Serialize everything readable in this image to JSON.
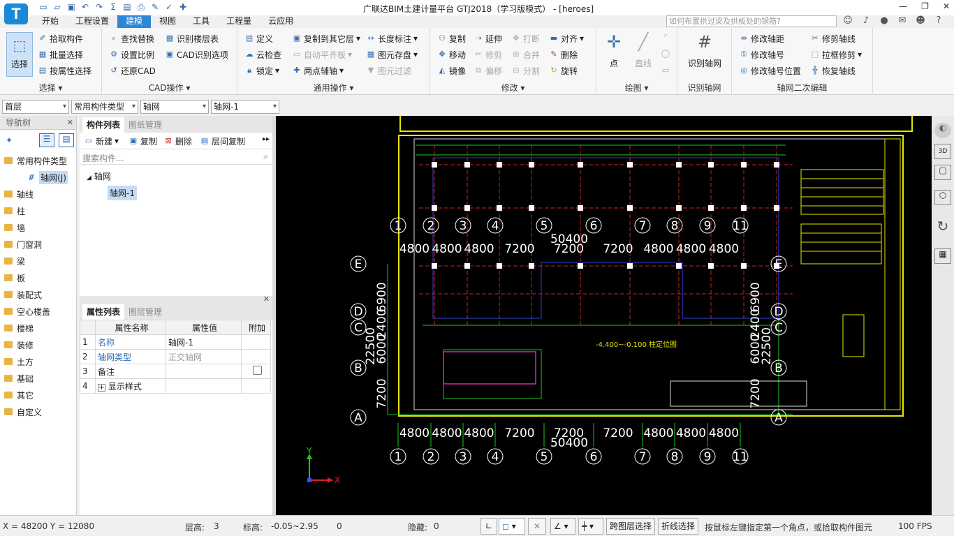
{
  "app": {
    "title": "广联达BIM土建计量平台 GTJ2018（学习版模式） - [heroes]",
    "logo": "T"
  },
  "menu": {
    "tabs": [
      "开始",
      "工程设置",
      "建模",
      "视图",
      "工具",
      "工程量",
      "云应用"
    ],
    "active": "建模"
  },
  "search": {
    "placeholder": "如何布置拱过梁及拱板处的钢筋?"
  },
  "ribbon": {
    "select": {
      "big": "选择",
      "items": [
        "拾取构件",
        "批量选择",
        "按属性选择"
      ],
      "label": "选择"
    },
    "cad": {
      "items": [
        "查找替换",
        "设置比例",
        "还原CAD",
        "识别楼层表",
        "CAD识别选项"
      ],
      "label": "CAD操作"
    },
    "common": {
      "items": [
        "定义",
        "云检查",
        "锁定",
        "复制到其它层",
        "自动平齐板",
        "两点辅轴",
        "长度标注",
        "图元存盘",
        "图元过滤"
      ],
      "label": "通用操作"
    },
    "modify": {
      "items": [
        "复制",
        "移动",
        "镜像",
        "延伸",
        "修剪",
        "偏移",
        "打断",
        "合并",
        "分割",
        "对齐",
        "删除",
        "旋转"
      ],
      "label": "修改"
    },
    "draw": {
      "items": [
        "点",
        "直线"
      ],
      "label": "绘图"
    },
    "identify": {
      "big": "识别轴网",
      "label": "识别轴网"
    },
    "axis2": {
      "items": [
        "修改轴距",
        "修改轴号",
        "修改轴号位置",
        "修剪轴线",
        "拉框修剪",
        "恢复轴线"
      ],
      "label": "轴网二次编辑"
    }
  },
  "toolbar": {
    "floor": "首层",
    "type": "常用构件类型",
    "category": "轴网",
    "element": "轴网-1"
  },
  "nav": {
    "title": "导航树",
    "group": "常用构件类型",
    "selected": "轴网(J)",
    "items": [
      "轴线",
      "柱",
      "墙",
      "门窗洞",
      "梁",
      "板",
      "装配式",
      "空心楼盖",
      "楼梯",
      "装修",
      "土方",
      "基础",
      "其它",
      "自定义"
    ]
  },
  "component_list": {
    "tabs": [
      "构件列表",
      "图纸管理"
    ],
    "actions": [
      "新建",
      "复制",
      "删除",
      "层间复制"
    ],
    "search_placeholder": "搜索构件...",
    "tree_root": "轴网",
    "tree_child": "轴网-1"
  },
  "properties": {
    "tabs": [
      "属性列表",
      "图层管理"
    ],
    "headers": [
      "属性名称",
      "属性值",
      "附加"
    ],
    "rows": [
      {
        "no": "1",
        "name": "名称",
        "value": "轴网-1"
      },
      {
        "no": "2",
        "name": "轴网类型",
        "value": "正交轴网"
      },
      {
        "no": "3",
        "name": "备注",
        "value": ""
      },
      {
        "no": "4",
        "name": "显示样式",
        "value": ""
      }
    ]
  },
  "cad": {
    "top_dims": [
      "4800",
      "4800",
      "4800",
      "7200",
      "7200",
      "7200",
      "4800",
      "4800",
      "4800"
    ],
    "total": "50400",
    "axis_nums": [
      "1",
      "2",
      "3",
      "4",
      "5",
      "6",
      "7",
      "8",
      "9",
      "11"
    ],
    "row_letters": [
      "E",
      "D",
      "C",
      "B",
      "A"
    ],
    "left_dims": [
      "6900",
      "2400",
      "6000",
      "7200"
    ],
    "left_total": "22500",
    "right_dims": [
      "6900",
      "2400",
      "6000",
      "7200"
    ],
    "right_total": "22500",
    "note": "-4.400~-0.100 柱定位图"
  },
  "status": {
    "coords": "X = 48200 Y = 12080",
    "floor_height_label": "层高:",
    "floor_height": "3",
    "elevation_label": "标高:",
    "elevation": "-0.05~2.95",
    "zero": "0",
    "hidden_label": "隐藏:",
    "hidden": "0",
    "btn_cross": "跨图层选择",
    "btn_polyline": "折线选择",
    "hint": "按鼠标左键指定第一个角点，或拾取构件图元",
    "fps": "100 FPS"
  }
}
